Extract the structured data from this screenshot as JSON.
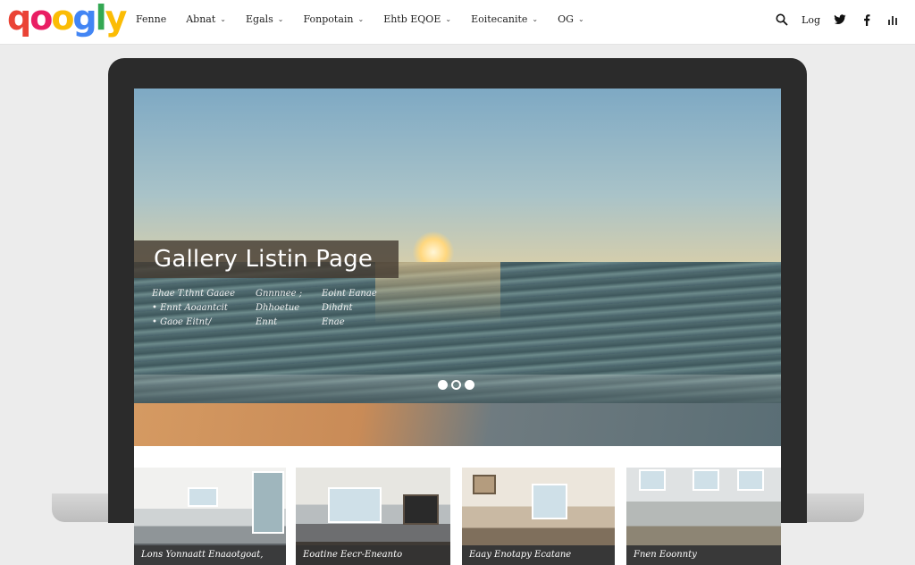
{
  "brand": {
    "letters": [
      {
        "char": "q",
        "color": "#ea4335"
      },
      {
        "char": "o",
        "color": "#e91e63"
      },
      {
        "char": "o",
        "color": "#fbbc05"
      },
      {
        "char": "g",
        "color": "#4285f4"
      },
      {
        "char": "l",
        "color": "#34a853"
      },
      {
        "char": "y",
        "color": "#fbbc05"
      }
    ]
  },
  "nav": {
    "items": [
      {
        "label": "Fenne",
        "has_dropdown": false
      },
      {
        "label": "Abnat",
        "has_dropdown": true
      },
      {
        "label": "Egals",
        "has_dropdown": true
      },
      {
        "label": "Fonpotain",
        "has_dropdown": true
      },
      {
        "label": "Ehtb EQOE",
        "has_dropdown": true
      },
      {
        "label": "Eoitecanite",
        "has_dropdown": true
      },
      {
        "label": "OG",
        "has_dropdown": true
      }
    ]
  },
  "topbar_right": {
    "search_icon": "search-icon",
    "login_label": "Log",
    "twitter_icon": "twitter-icon",
    "facebook_icon": "facebook-icon",
    "stats_icon": "bar-chart-icon"
  },
  "hero": {
    "title": "Gallery Listin Page",
    "caption_columns": [
      [
        "Ehae T.thnt Gaaee",
        "Ennt Aoaantcit",
        "Gaoe Eitnt/"
      ],
      [
        "Gnnnnee ;",
        "Dhhoetue",
        "Ennt"
      ],
      [
        "Eoint Eanae",
        "Dihdnt",
        "Enae"
      ]
    ],
    "caption_bullets": [
      false,
      true,
      true
    ],
    "slides": 3,
    "active_slide": 2
  },
  "cards": [
    {
      "label": "Lons Yonnaatt Enaaotgoat,"
    },
    {
      "label": "Eoatine Eecr-Eneanto"
    },
    {
      "label": "Eaay Enotapy Ecatane"
    },
    {
      "label": "Fnen Eoonnty"
    }
  ],
  "colors": {
    "accent_dark": "#2b2b2b",
    "title_box": "#463c32"
  }
}
